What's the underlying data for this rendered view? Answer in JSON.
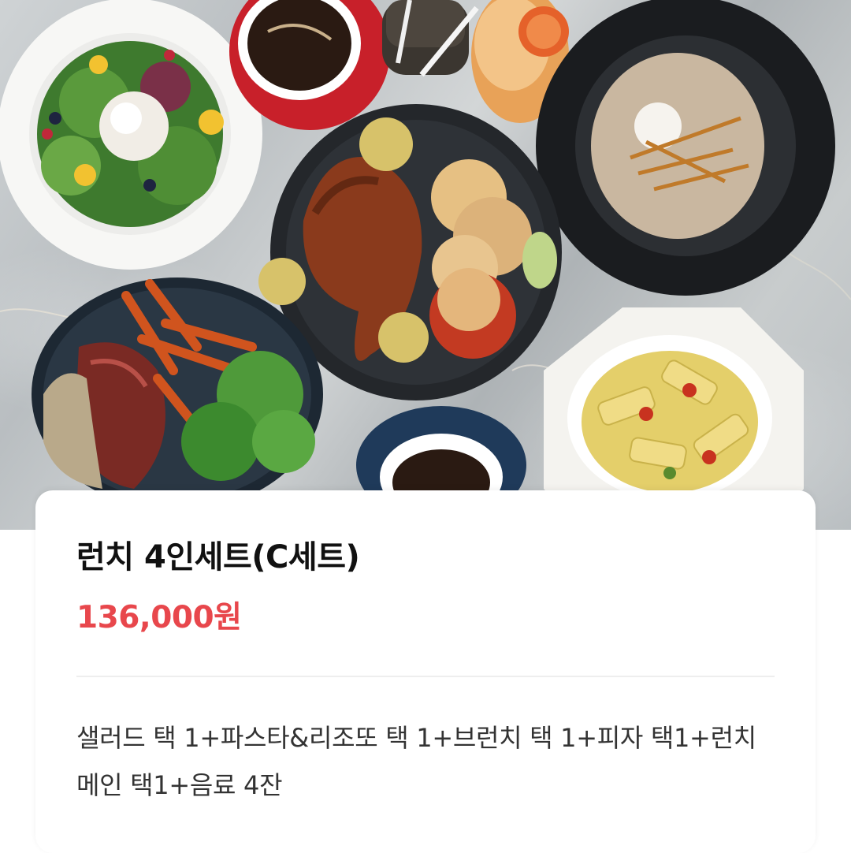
{
  "hero_image": {
    "alt": "",
    "colors": {
      "marble": "#c5c9cb",
      "plate_dark": "#24272b",
      "plate_white": "#f7f7f5",
      "saucer_red": "#c8202a",
      "saucer_navy": "#1f3a5a"
    }
  },
  "product": {
    "title": "런치 4인세트(C세트)",
    "price": "136,000원",
    "description": "샐러드 택 1+파스타&리조또 택 1+브런치 택 1+피자 택1+런치 메인 택1+음료 4잔"
  },
  "colors": {
    "price": "#e8474c",
    "title": "#111111",
    "description": "#333333",
    "divider": "#eeeeee"
  }
}
